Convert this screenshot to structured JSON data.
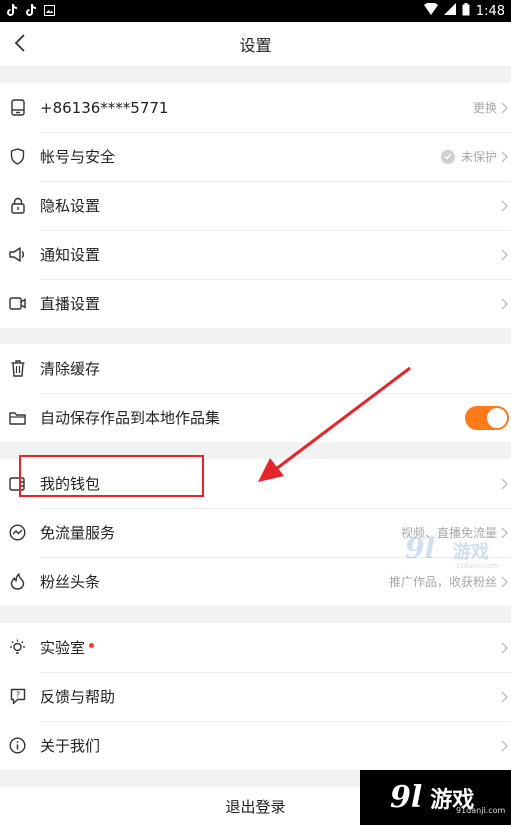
{
  "status_bar": {
    "left_icons": [
      "tiktok-icon",
      "tiktok-icon",
      "image-icon"
    ],
    "time": "1:48"
  },
  "nav": {
    "title": "设置"
  },
  "groups": {
    "account": [
      {
        "icon": "phone-icon",
        "label": "+86136****5771",
        "value": "更换"
      },
      {
        "icon": "shield-icon",
        "label": "帐号与安全",
        "value": "未保护"
      },
      {
        "icon": "lock-icon",
        "label": "隐私设置",
        "value": ""
      },
      {
        "icon": "speaker-icon",
        "label": "通知设置",
        "value": ""
      },
      {
        "icon": "video-camera-icon",
        "label": "直播设置",
        "value": ""
      }
    ],
    "storage": [
      {
        "icon": "trash-icon",
        "label": "清除缓存"
      },
      {
        "icon": "folder-icon",
        "label": "自动保存作品到本地作品集",
        "toggle_on": true
      }
    ],
    "services": [
      {
        "icon": "wallet-icon",
        "label": "我的钱包",
        "value": ""
      },
      {
        "icon": "traffic-icon",
        "label": "免流量服务",
        "value": "视频、直播免流量"
      },
      {
        "icon": "flame-icon",
        "label": "粉丝头条",
        "value": "推广作品，收获粉丝"
      }
    ],
    "misc": [
      {
        "icon": "bulb-icon",
        "label": "实验室",
        "value": ""
      },
      {
        "icon": "feedback-icon",
        "label": "反馈与帮助",
        "value": ""
      },
      {
        "icon": "info-icon",
        "label": "关于我们",
        "value": ""
      }
    ]
  },
  "logout": {
    "label": "退出登录"
  },
  "watermark": {
    "number": "9l",
    "text": "游戏",
    "domain": "91danji.com"
  },
  "colors": {
    "accent": "#ff7a1a",
    "highlight": "#e2262b",
    "lab_dot": "#ff3b30"
  }
}
